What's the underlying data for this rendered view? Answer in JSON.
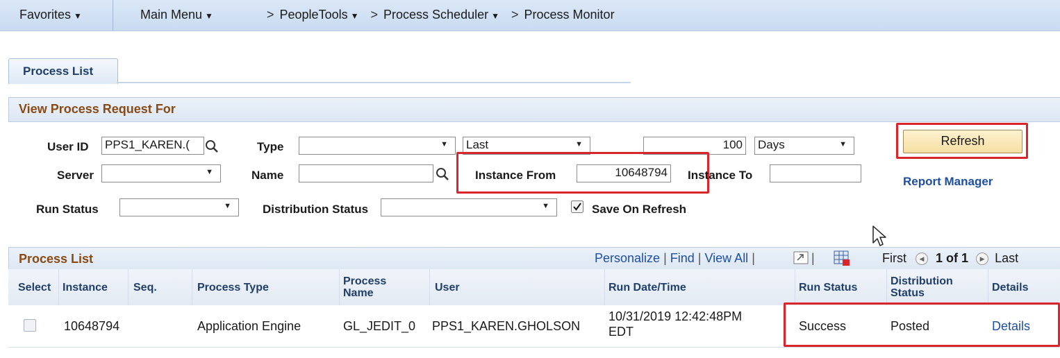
{
  "nav": {
    "favorites": "Favorites",
    "main_menu": "Main Menu",
    "breadcrumb": [
      "PeopleTools",
      "Process Scheduler",
      "Process Monitor"
    ]
  },
  "tab": {
    "label": "Process List"
  },
  "filter": {
    "title": "View Process Request For",
    "user_id_label": "User ID",
    "user_id_value": "PPS1_KAREN.(",
    "type_label": "Type",
    "type_value": "",
    "last_value": "Last",
    "days_value": "100",
    "days_unit": "Days",
    "server_label": "Server",
    "server_value": "",
    "name_label": "Name",
    "name_value": "",
    "instance_from_label": "Instance From",
    "instance_from_value": "10648794",
    "instance_to_label": "Instance To",
    "instance_to_value": "",
    "run_status_label": "Run Status",
    "run_status_value": "",
    "dist_status_label": "Distribution Status",
    "dist_status_value": "",
    "save_on_refresh_label": "Save On Refresh",
    "save_on_refresh_checked": true,
    "refresh_label": "Refresh",
    "report_manager_label": "Report Manager"
  },
  "grid": {
    "title": "Process List",
    "personalize": "Personalize",
    "find": "Find",
    "view_all": "View All",
    "first": "First",
    "page": "1 of 1",
    "last": "Last",
    "columns": [
      "Select",
      "Instance",
      "Seq.",
      "Process Type",
      "Process Name",
      "User",
      "Run Date/Time",
      "Run Status",
      "Distribution Status",
      "Details"
    ],
    "rows": [
      {
        "instance": "10648794",
        "seq": "",
        "process_type": "Application Engine",
        "process_name": "GL_JEDIT_0",
        "user": "PPS1_KAREN.GHOLSON",
        "run_date": "10/31/2019 12:42:48PM",
        "run_tz": "EDT",
        "run_status": "Success",
        "dist_status": "Posted",
        "details": "Details"
      }
    ]
  },
  "colors": {
    "accent_red": "#d9262c",
    "link_blue": "#1f4fa0",
    "header_brown": "#8a4a14"
  }
}
